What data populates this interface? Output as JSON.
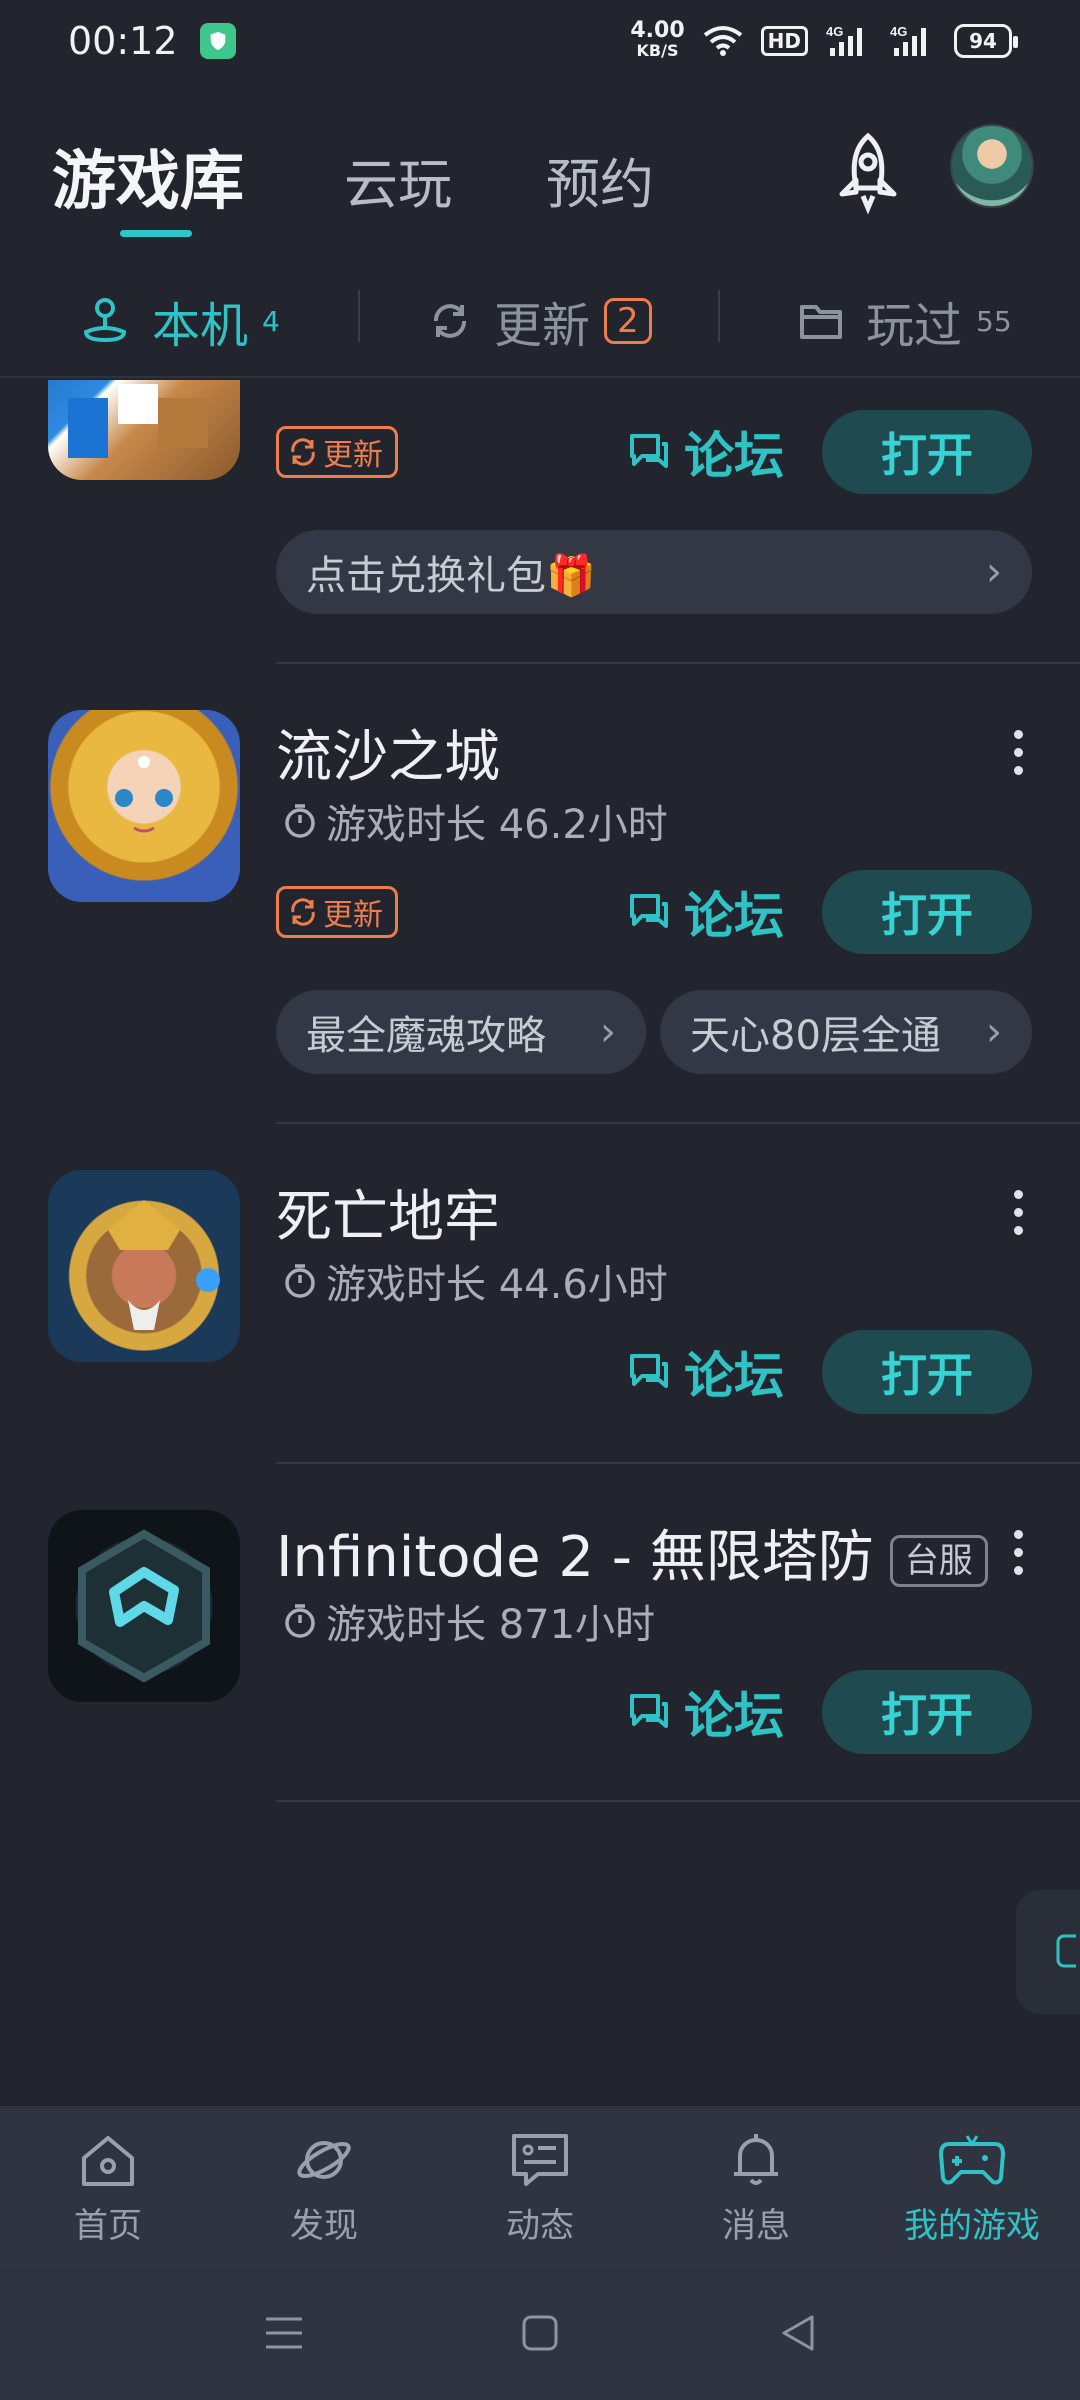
{
  "status_bar": {
    "time": "00:12",
    "net_speed_value": "4.00",
    "net_speed_unit": "KB/S",
    "hd_badge": "HD",
    "signal1": "4G",
    "signal2": "4G",
    "battery": "94"
  },
  "header": {
    "tabs": [
      {
        "label": "游戏库",
        "active": true
      },
      {
        "label": "云玩",
        "active": false
      },
      {
        "label": "预约",
        "active": false
      }
    ]
  },
  "subtabs": [
    {
      "label": "本机",
      "count": "4",
      "icon": "joystick-icon",
      "active": true
    },
    {
      "label": "更新",
      "count": "2",
      "icon": "refresh-icon",
      "active": false
    },
    {
      "label": "玩过",
      "count": "55",
      "icon": "folder-icon",
      "active": false
    }
  ],
  "games": [
    {
      "title": "",
      "update_label": "更新",
      "forum_label": "论坛",
      "open_label": "打开",
      "chips": [
        "点击兑换礼包🎁"
      ]
    },
    {
      "title": "流沙之城",
      "playtime": "游戏时长 46.2小时",
      "update_label": "更新",
      "forum_label": "论坛",
      "open_label": "打开",
      "chips": [
        "最全魔魂攻略",
        "天心80层全通"
      ]
    },
    {
      "title": "死亡地牢",
      "playtime": "游戏时长 44.6小时",
      "forum_label": "论坛",
      "open_label": "打开"
    },
    {
      "title": "Infinitode 2 - 無限塔防",
      "region_tag": "台服",
      "playtime": "游戏时长 871小时",
      "forum_label": "论坛",
      "open_label": "打开"
    }
  ],
  "bottom_nav": [
    {
      "label": "首页",
      "icon": "home-icon"
    },
    {
      "label": "发现",
      "icon": "planet-icon"
    },
    {
      "label": "动态",
      "icon": "chat-card-icon"
    },
    {
      "label": "消息",
      "icon": "bell-icon"
    },
    {
      "label": "我的游戏",
      "icon": "gamepad-icon",
      "active": true
    }
  ],
  "colors": {
    "background": "#22252e",
    "accent": "#2fc3c6",
    "update_orange": "#ee7d4b",
    "open_button_bg": "#1f4a4f"
  }
}
